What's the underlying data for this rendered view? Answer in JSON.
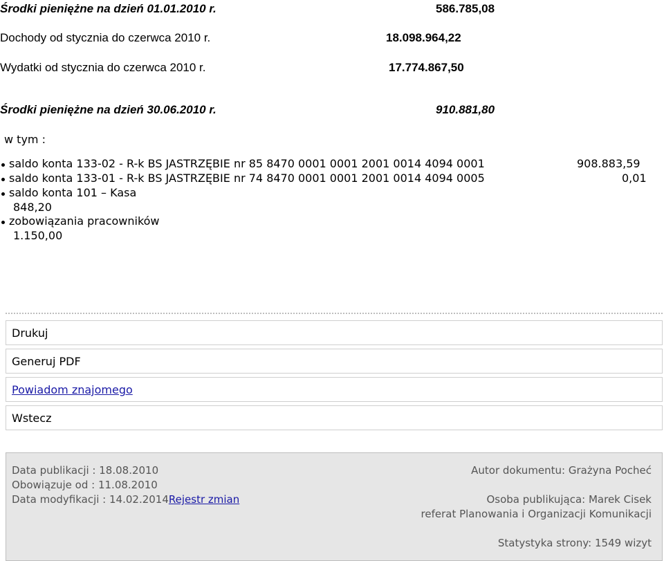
{
  "summary": {
    "opening_label": "Środki pieniężne na dzień 01.01.2010 r.",
    "opening_amount": "586.785,08",
    "income_label": "Dochody od stycznia do czerwca 2010 r.",
    "income_amount": "18.098.964,22",
    "expense_label": "Wydatki od stycznia do czerwca 2010 r.",
    "expense_amount": "17.774.867,50",
    "closing_label": "Środki pieniężne na dzień 30.06.2010 r.",
    "closing_amount": "910.881,80"
  },
  "breakdown": {
    "intro": "w tym :",
    "items": [
      {
        "label": "saldo konta 133-02 - R-k BS JASTRZĘBIE nr 85 8470 0001 0001 2001 0014 4094 0001",
        "amount": "908.883,59"
      },
      {
        "label": "saldo konta 133-01 - R-k BS JASTRZĘBIE nr 74 8470 0001 0001 2001 0014 4094 0005",
        "amount": "0,01"
      },
      {
        "label": "saldo konta 101 – Kasa",
        "amount": "848,20"
      },
      {
        "label": "zobowiązania pracowników",
        "amount": "1.150,00"
      }
    ]
  },
  "menu": {
    "print": "Drukuj",
    "pdf": "Generuj PDF",
    "notify": "Powiadom znajomego",
    "back": "Wstecz"
  },
  "footer": {
    "published": "Data publikacji : 18.08.2010",
    "valid_from": "Obowiązuje od : 11.08.2010",
    "modified": "Data modyfikacji : 14.02.2014",
    "changelog_link": "Rejestr zmian",
    "author": "Autor dokumentu: Grażyna Pocheć",
    "publisher": "Osoba publikująca: Marek Cisek",
    "department": "referat Planowania i Organizacji Komunikacji",
    "stats": "Statystyka strony: 1549 wizyt"
  },
  "colors": {
    "link": "#1a1aa6",
    "footer_bg": "#e6e6e6",
    "footer_text": "#555555"
  }
}
